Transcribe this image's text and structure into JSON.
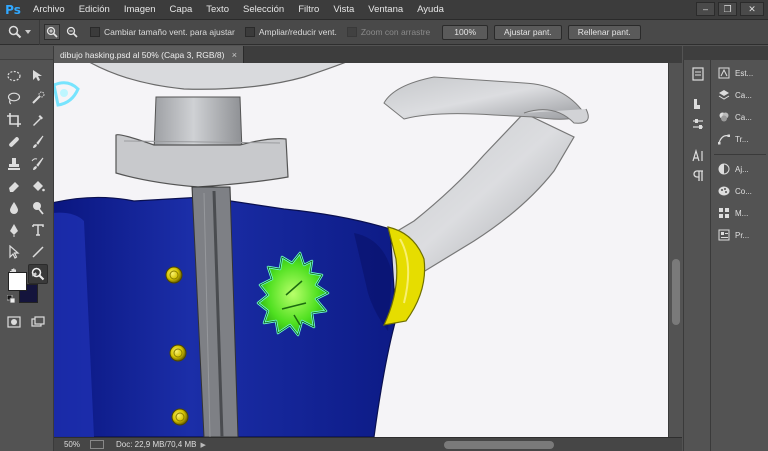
{
  "app": {
    "logo": "Ps"
  },
  "menu": [
    "Archivo",
    "Edición",
    "Imagen",
    "Capa",
    "Texto",
    "Selección",
    "Filtro",
    "Vista",
    "Ventana",
    "Ayuda"
  ],
  "window_controls": {
    "minimize": "–",
    "restore": "❐",
    "close": "✕"
  },
  "options": {
    "resize_windows": "Cambiar tamaño vent. para ajustar",
    "zoom_all_windows": "Ampliar/reducir vent.",
    "scrubby_zoom": "Zoom con arrastre",
    "btn_100": "100%",
    "btn_fit": "Ajustar pant.",
    "btn_fill": "Rellenar pant."
  },
  "document": {
    "tab_title": "dibujo hasking.psd al 50% (Capa 3, RGB/8)",
    "zoom": "50%",
    "doc_info": "Doc: 22,9 MB/70,4 MB"
  },
  "panels": [
    {
      "label": "Est..."
    },
    {
      "label": "Ca..."
    },
    {
      "label": "Ca..."
    },
    {
      "label": "Tr..."
    },
    {
      "label": "Aj..."
    },
    {
      "label": "Co..."
    },
    {
      "label": "M..."
    },
    {
      "label": "Pr..."
    }
  ],
  "colors": {
    "foreground": "#ffffff",
    "background": "#14143c",
    "accent": "#31a8ff"
  }
}
